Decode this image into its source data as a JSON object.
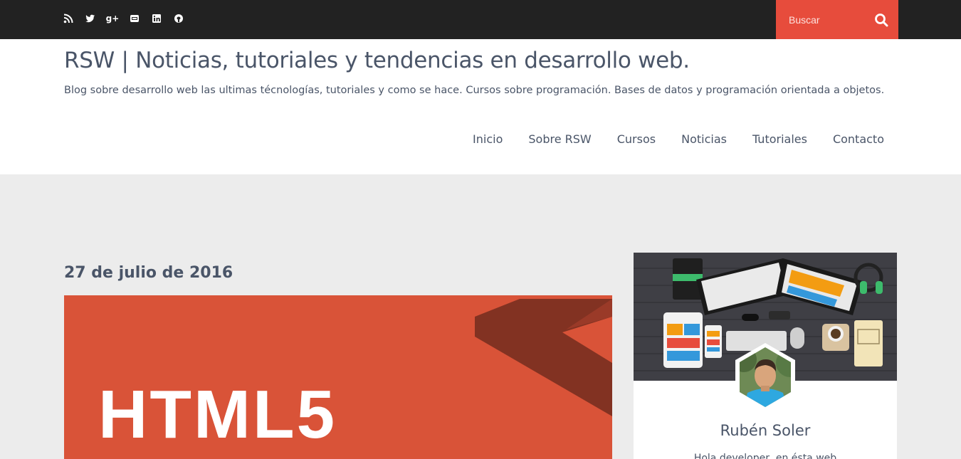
{
  "topbar": {
    "social_icons": [
      "rss-icon",
      "twitter-icon",
      "google-plus-icon",
      "youtube-icon",
      "linkedin-icon",
      "github-icon"
    ],
    "search": {
      "placeholder": "Buscar",
      "icon": "search-icon"
    }
  },
  "header": {
    "title": "RSW | Noticias, tutoriales y tendencias en desarrollo web.",
    "tagline": "Blog sobre desarrollo web las ultimas técnologías, tutoriales y como se hace. Cursos sobre programación. Bases de datos y programación orientada a objetos."
  },
  "nav": {
    "items": [
      {
        "label": "Inicio"
      },
      {
        "label": "Sobre RSW"
      },
      {
        "label": "Cursos"
      },
      {
        "label": "Noticias"
      },
      {
        "label": "Tutoriales"
      },
      {
        "label": "Contacto"
      }
    ]
  },
  "post": {
    "date": "27 de julio de 2016",
    "image_text": "HTML5"
  },
  "sidebar": {
    "profile": {
      "name": "Rubén Soler",
      "bio": "Hola developer, en ésta web"
    }
  },
  "colors": {
    "topbar": "#222222",
    "accent": "#e74c3c",
    "post_image": "#d95338",
    "page_bg": "#ececec",
    "text": "#4a5568"
  }
}
